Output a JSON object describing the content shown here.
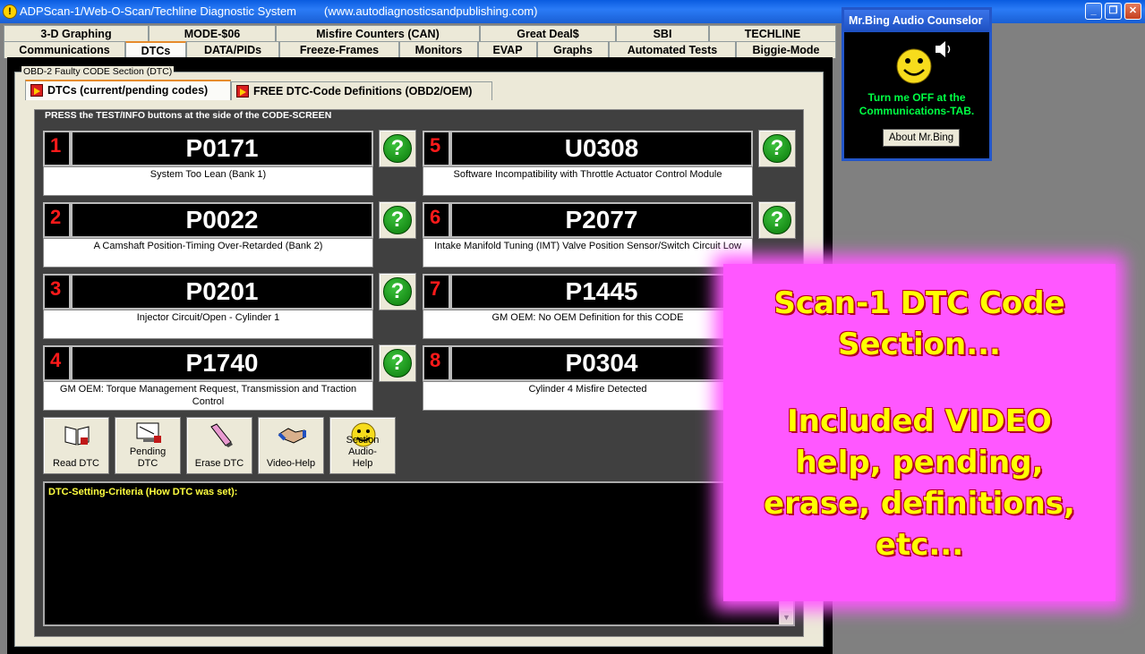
{
  "window": {
    "title": "ADPScan-1/Web-O-Scan/Techline Diagnostic System",
    "url": "(www.autodiagnosticsandpublishing.com)",
    "app_icon": "!",
    "minimize": "_",
    "maximize": "❐",
    "close": "✕"
  },
  "tabs_row1": [
    "3-D Graphing",
    "MODE-$06",
    "Misfire Counters (CAN)",
    "Great Deal$",
    "SBI",
    "TECHLINE"
  ],
  "tabs_row2": [
    "Communications",
    "DTCs",
    "DATA/PIDs",
    "Freeze-Frames",
    "Monitors",
    "EVAP",
    "Graphs",
    "Automated Tests",
    "Biggie-Mode"
  ],
  "selected_tab": "DTCs",
  "section": {
    "group_label": "OBD-2 Faulty CODE Section (DTC)",
    "subtabs": [
      "DTCs (current/pending codes)",
      "FREE DTC-Code Definitions (OBD2/OEM)"
    ],
    "code_screen_label": "PRESS the TEST/INFO buttons at the side of the CODE-SCREEN",
    "help_glyph": "?",
    "dtcs": [
      {
        "num": "1",
        "code": "P0171",
        "def": "System Too Lean (Bank 1)"
      },
      {
        "num": "2",
        "code": "P0022",
        "def": "A Camshaft Position-Timing Over-Retarded (Bank 2)"
      },
      {
        "num": "3",
        "code": "P0201",
        "def": "Injector Circuit/Open - Cylinder 1"
      },
      {
        "num": "4",
        "code": "P1740",
        "def": "GM OEM: Torque Management Request, Transmission and Traction Control"
      },
      {
        "num": "5",
        "code": "U0308",
        "def": "Software Incompatibility with Throttle Actuator Control Module"
      },
      {
        "num": "6",
        "code": "P2077",
        "def": "Intake Manifold Tuning (IMT) Valve Position Sensor/Switch Circuit Low"
      },
      {
        "num": "7",
        "code": "P1445",
        "def": "GM OEM: No OEM Definition for this CODE"
      },
      {
        "num": "8",
        "code": "P0304",
        "def": "Cylinder 4 Misfire Detected"
      }
    ],
    "tools": [
      {
        "label": "Read DTC",
        "icon": "book-icon"
      },
      {
        "label": "Pending DTC",
        "icon": "monitor-icon"
      },
      {
        "label": "Erase DTC",
        "icon": "eraser-icon"
      },
      {
        "label": "Video-Help",
        "icon": "handshake-icon"
      },
      {
        "label": "Section Audio-Help",
        "icon": "smiley-icon"
      }
    ],
    "criteria_label": "DTC-Setting-Criteria (How DTC was set):"
  },
  "bing": {
    "title": "Mr.Bing Audio Counselor",
    "message_line1": "Turn me OFF at the",
    "message_line2": "Communications-TAB.",
    "about_button": "About Mr.Bing"
  },
  "overlay": {
    "lines": [
      "Scan-1 DTC Code",
      "Section...",
      "",
      "Included VIDEO",
      "help, pending,",
      "erase, definitions,",
      "etc..."
    ]
  }
}
